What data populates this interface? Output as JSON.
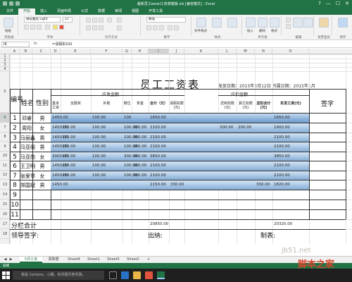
{
  "window": {
    "title": "最新员工excel工资表模板.xls [兼容模式] - Excel",
    "controls": [
      "?",
      "—",
      "☐",
      "✕"
    ]
  },
  "ribbon_tabs": [
    "文件",
    "开始",
    "插入",
    "页面布局",
    "公式",
    "数据",
    "审阅",
    "视图",
    "开发工具"
  ],
  "ribbon": {
    "font_name": "微软雅黑 Light",
    "font_size": "11",
    "number_format": "数值",
    "groups": [
      "剪贴板",
      "字体",
      "对齐方式",
      "数字",
      "样式",
      "单元格",
      "编辑",
      "发票查验",
      "保存"
    ],
    "buttons": [
      "粘贴",
      "条件格式",
      "套用表格格式",
      "单元格样式",
      "插入",
      "删除",
      "格式",
      "排序和筛选",
      "查找和选择",
      "发票查验",
      "保存到百度网盘"
    ]
  },
  "formula_bar": {
    "name_box": "I6",
    "fx": "fx",
    "value": "=请假扣102"
  },
  "columns": [
    "A",
    "B",
    "C",
    "D",
    "E",
    "F",
    "G",
    "H",
    "I",
    "J",
    "K",
    "L",
    "M",
    "N",
    "O"
  ],
  "rows": [
    "1",
    "2",
    "3",
    "4",
    "5",
    "6",
    "7",
    "8",
    "9",
    "10",
    "11",
    "12",
    "13",
    "14",
    "15",
    "16",
    "17",
    "18",
    "19",
    "20",
    "21",
    "22",
    "23",
    "24",
    "25",
    "26",
    "27",
    "28",
    "29",
    "30"
  ],
  "sheet": {
    "title": "员工工资表",
    "pay_date": "发放日期：2015年2月12日  所属日期：2015年1月",
    "headers": {
      "no": "编号",
      "name": "姓名",
      "gender": "性别",
      "payable": "应发金额",
      "deduct": "应扣金额",
      "base": "基本工资",
      "attendance": "全勤奖",
      "subsidy": "补助",
      "post": "岗位",
      "bonus": "奖金",
      "total": "合计（元）",
      "leave": "请假扣款(元)",
      "late": "迟到扣款(元)",
      "other": "其它扣款(元)",
      "deduct_total": "应扣合计(元)",
      "actual": "实发工资(元)",
      "sign": "签字"
    },
    "employees": [
      {
        "no": "1",
        "name": "邓睿",
        "gender": "男",
        "base": "1450.00",
        "attendance": "",
        "subsidy": "100.00",
        "post": "100",
        "bonus": "",
        "total": "1650.00",
        "leave": "",
        "late": "",
        "other": "",
        "deduct_total": "",
        "actual": "1650.00"
      },
      {
        "no": "2",
        "name": "周阳",
        "gender": "女",
        "base": "1450.00",
        "attendance": "150.00",
        "subsidy": "100.00",
        "post": "100.00",
        "bonus": "300.00",
        "total": "2100.00",
        "leave": "",
        "late": "200.00",
        "other": "200.00",
        "deduct_total": "",
        "actual": "1900.00"
      },
      {
        "no": "3",
        "name": "马丽鑫",
        "gender": "男",
        "base": "1450.00",
        "attendance": "150.00",
        "subsidy": "100.00",
        "post": "100.00",
        "bonus": "300.00",
        "total": "2100.00",
        "leave": "",
        "late": "",
        "other": "",
        "deduct_total": "",
        "actual": "2100.00"
      },
      {
        "no": "4",
        "name": "马亚阁",
        "gender": "男",
        "base": "1450.00",
        "attendance": "150.00",
        "subsidy": "100.00",
        "post": "100.00",
        "bonus": "300.00",
        "total": "2100.00",
        "leave": "",
        "late": "",
        "other": "",
        "deduct_total": "",
        "actual": "2100.00"
      },
      {
        "no": "5",
        "name": "马亚勋",
        "gender": "女",
        "base": "3000.00",
        "attendance": "150.00",
        "subsidy": "100.00",
        "post": "300.00",
        "bonus": "300.00",
        "total": "3850.00",
        "leave": "",
        "late": "",
        "other": "",
        "deduct_total": "",
        "actual": "3850.00"
      },
      {
        "no": "6",
        "name": "王卫明",
        "gender": "男",
        "base": "1450.00",
        "attendance": "150.00",
        "subsidy": "100.00",
        "post": "100.00",
        "bonus": "300.00",
        "total": "2100.00",
        "leave": "",
        "late": "",
        "other": "",
        "deduct_total": "",
        "actual": "2100.00"
      },
      {
        "no": "7",
        "name": "张爱琴",
        "gender": "女",
        "base": "1450.00",
        "attendance": "150.00",
        "subsidy": "100.00",
        "post": "100.00",
        "bonus": "300.00",
        "total": "2100.00",
        "leave": "",
        "late": "",
        "other": "",
        "deduct_total": "",
        "actual": "2100.00"
      },
      {
        "no": "8",
        "name": "郑国斌",
        "gender": "男",
        "base": "1450.00",
        "attendance": "",
        "subsidy": "",
        "post": "",
        "bonus": "",
        "total": "2150.00",
        "leave": "330.00",
        "late": "",
        "other": "",
        "deduct_total": "330.00",
        "actual": "1820.00"
      }
    ],
    "empty_rows": [
      "9",
      "10",
      "11"
    ],
    "summary_label": "分栏合计",
    "summary_total": "20850.00",
    "summary_actual": "20320.00",
    "footer": {
      "leader": "领导签字:",
      "cashier": "出纳:",
      "maker": "制表:"
    }
  },
  "sheet_tabs": [
    "5月工资",
    "源数据",
    "Sheet4",
    "Sheet1",
    "Sheet5",
    "Sheet2",
    "+"
  ],
  "status": "就绪",
  "taskbar": {
    "cortana_placeholder": "我是 Cortana，小娜。有问题尽管问我。"
  },
  "watermark": {
    "site": "jb51.net",
    "brand": "脚本之家"
  },
  "colors": {
    "excel_green": "#217346",
    "band_blue": "#a7c6e4"
  }
}
